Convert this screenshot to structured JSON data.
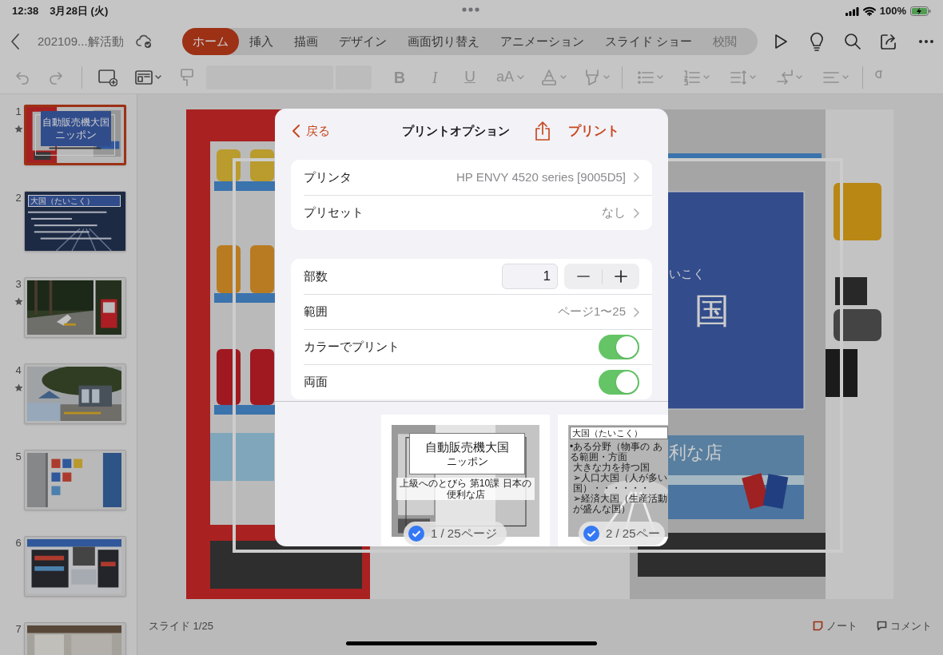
{
  "status_bar": {
    "time": "12:38",
    "date": "3月28日 (火)",
    "battery": "100%"
  },
  "toolbar": {
    "document_title": "202109...解活動",
    "tabs": [
      {
        "label": "ホーム",
        "selected": true
      },
      {
        "label": "挿入",
        "selected": false
      },
      {
        "label": "描画",
        "selected": false
      },
      {
        "label": "デザイン",
        "selected": false
      },
      {
        "label": "画面切り替え",
        "selected": false
      },
      {
        "label": "アニメーション",
        "selected": false
      },
      {
        "label": "スライド ショー",
        "selected": false
      },
      {
        "label": "校閲",
        "selected": false
      }
    ]
  },
  "ribbon": {
    "format_buttons": [
      "B",
      "I",
      "U",
      "aA"
    ]
  },
  "slides": [
    {
      "number": "1",
      "starred": true,
      "selected": true,
      "kind": "title",
      "title": "自動販売機大国",
      "subtitle": "ニッポン"
    },
    {
      "number": "2",
      "starred": false,
      "selected": false,
      "kind": "text",
      "title": "大国（たいこく）"
    },
    {
      "number": "3",
      "starred": true,
      "selected": false,
      "kind": "picture"
    },
    {
      "number": "4",
      "starred": true,
      "selected": false,
      "kind": "picture"
    },
    {
      "number": "5",
      "starred": false,
      "selected": false,
      "kind": "picture"
    },
    {
      "number": "6",
      "starred": false,
      "selected": false,
      "kind": "picture"
    },
    {
      "number": "7",
      "starred": false,
      "selected": false,
      "kind": "picture"
    }
  ],
  "slide_canvas": {
    "ruby": "いこく",
    "title": "国",
    "caption": "利な店"
  },
  "print_dialog": {
    "back": "戻る",
    "title": "プリントオプション",
    "action": "プリント",
    "groups": [
      [
        {
          "kind": "link",
          "label": "プリンタ",
          "value": "HP ENVY 4520 series [9005D5]"
        },
        {
          "kind": "link",
          "label": "プリセット",
          "value": "なし"
        }
      ],
      [
        {
          "kind": "stepper",
          "label": "部数",
          "value": "1"
        },
        {
          "kind": "link",
          "label": "範囲",
          "value": "ページ1〜25"
        },
        {
          "kind": "toggle",
          "label": "カラーでプリント",
          "on": true
        },
        {
          "kind": "toggle",
          "label": "両面",
          "on": true
        }
      ]
    ],
    "pages": [
      {
        "kind": "title",
        "title": "自動販売機大国",
        "subtitle": "ニッポン",
        "footer": "上級へのとびら 第10課 日本の便利な店",
        "caption": "1 / 25ページ",
        "selected": true
      },
      {
        "kind": "text",
        "title": "大国（たいこく）",
        "lines": [
          "•ある分野（物事の ある範囲・方面",
          "大きな力を持つ国",
          "➢人口大国（人が多い国）・・・・・・",
          "➢経済大国（生産活動が盛んな国）"
        ],
        "caption": "2 / 25ペー",
        "selected": true
      }
    ]
  },
  "footer": {
    "slide_counter": "スライド 1/25",
    "notes": "ノート",
    "comments": "コメント"
  }
}
